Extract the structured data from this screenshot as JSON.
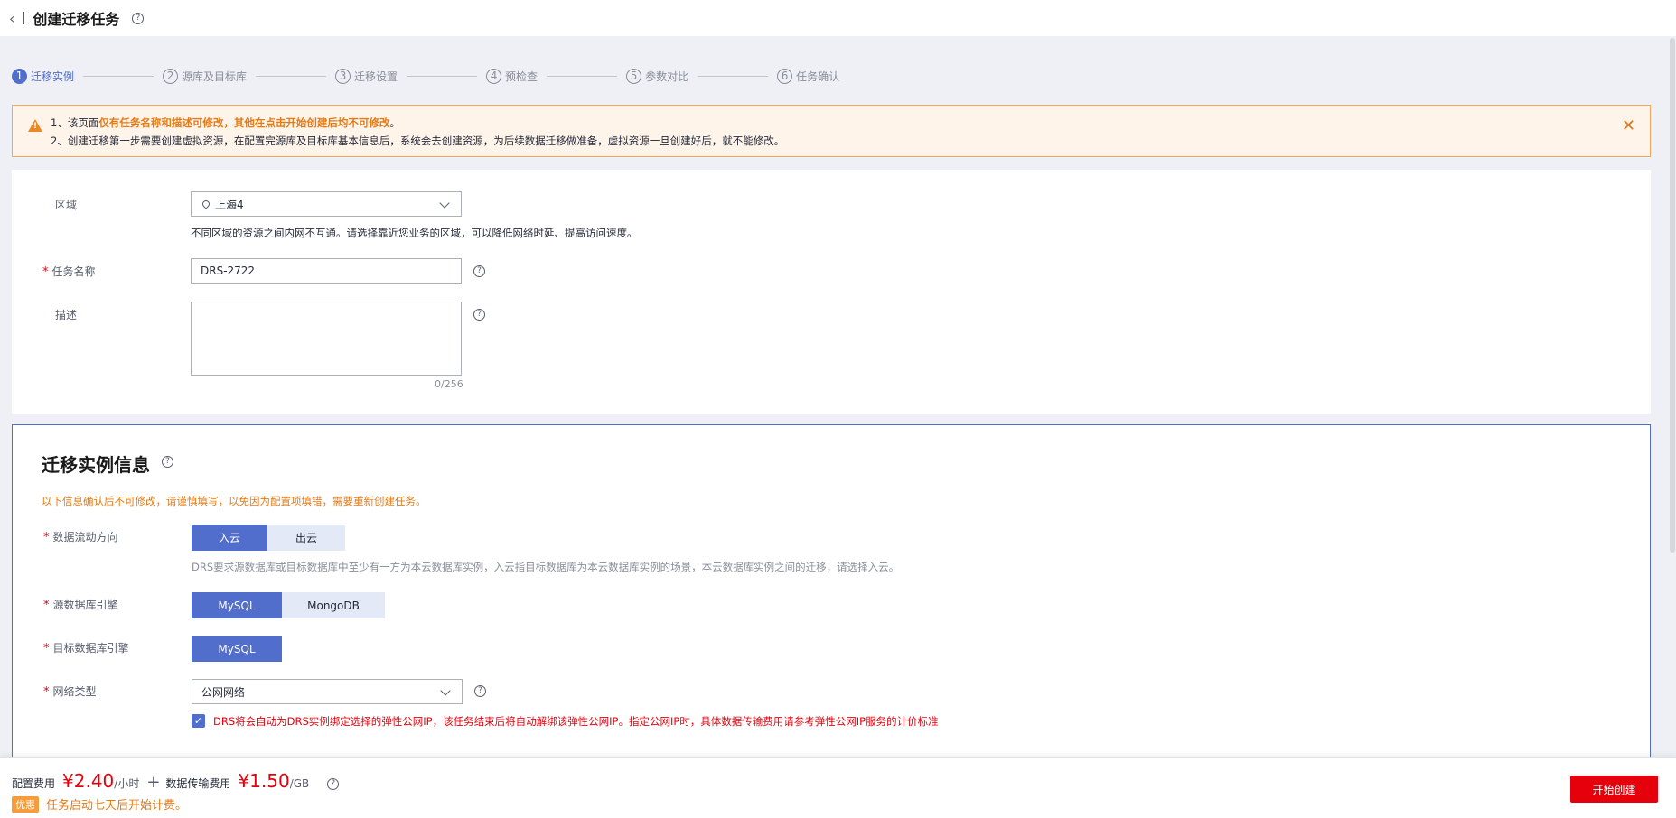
{
  "header": {
    "back_icon": "chevron-left-icon",
    "title": "创建迁移任务"
  },
  "steps": [
    {
      "num": "1",
      "label": "迁移实例"
    },
    {
      "num": "2",
      "label": "源库及目标库"
    },
    {
      "num": "3",
      "label": "迁移设置"
    },
    {
      "num": "4",
      "label": "预检查"
    },
    {
      "num": "5",
      "label": "参数对比"
    },
    {
      "num": "6",
      "label": "任务确认"
    }
  ],
  "alert": {
    "line1_prefix": "1、该页面",
    "line1_highlight": "仅有任务名称和描述可修改，其他在点击开始创建后均不可修改",
    "line1_suffix": "。",
    "line2": "2、创建迁移第一步需要创建虚拟资源，在配置完源库及目标库基本信息后，系统会去创建资源，为后续数据迁移做准备，虚拟资源一旦创建好后，就不能修改。"
  },
  "basic_form": {
    "region_label": "区域",
    "region_value": "上海4",
    "region_hint": "不同区域的资源之间内网不互通。请选择靠近您业务的区域，可以降低网络时延、提高访问速度。",
    "task_name_label": "任务名称",
    "task_name_value": "DRS-2722",
    "desc_label": "描述",
    "desc_counter": "0/256"
  },
  "instance_info": {
    "title": "迁移实例信息",
    "warning": "以下信息确认后不可修改，请谨慎填写，以免因为配置项填错，需要重新创建任务。",
    "flow_label": "数据流动方向",
    "flow_options": [
      "入云",
      "出云"
    ],
    "flow_desc": "DRS要求源数据库或目标数据库中至少有一方为本云数据库实例，入云指目标数据库为本云数据库实例的场景，本云数据库实例之间的迁移，请选择入云。",
    "source_engine_label": "源数据库引擎",
    "source_engine_options": [
      "MySQL",
      "MongoDB"
    ],
    "target_engine_label": "目标数据库引擎",
    "target_engine_options": [
      "MySQL"
    ],
    "network_label": "网络类型",
    "network_value": "公网网络",
    "eip_note": "DRS将会自动为DRS实例绑定选择的弹性公网IP，该任务结束后将自动解绑该弹性公网IP。指定公网IP时，具体数据传输费用请参考弹性公网IP服务的计价标准"
  },
  "footer": {
    "config_fee_label": "配置费用",
    "config_fee_value": "¥2.40",
    "config_fee_unit": "/小时",
    "plus": "+",
    "transfer_fee_label": "数据传输费用",
    "transfer_fee_value": "¥1.50",
    "transfer_fee_unit": "/GB",
    "badge": "优惠",
    "promo": "任务启动七天后开始计费。",
    "create_button": "开始创建"
  },
  "colors": {
    "primary": "#526ecc",
    "danger": "#e6000c",
    "warning": "#e37a16"
  }
}
